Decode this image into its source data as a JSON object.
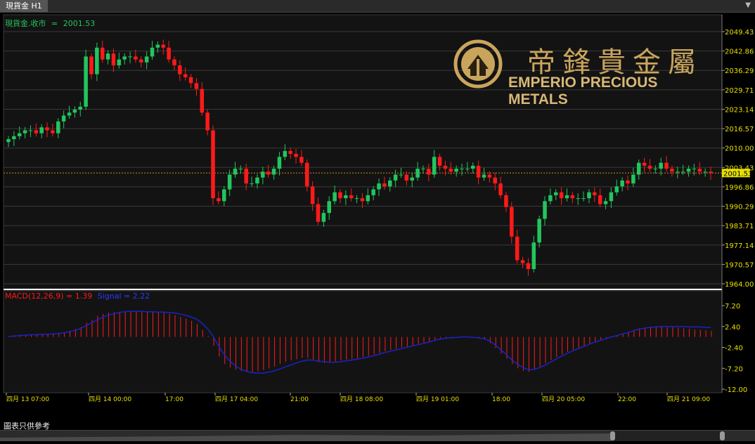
{
  "tab": {
    "label": "現貨金 H1"
  },
  "price_header": {
    "label": "現貨金.收市",
    "eq": "=",
    "value": "2001.53"
  },
  "macd_header": {
    "label": "MACD(12,26,9) = 1.39",
    "signal": "Signal = 2.22"
  },
  "logo": {
    "cn": "帝鋒貴金屬",
    "en": "EMPERIO PRECIOUS METALS"
  },
  "disclaimer": "圖表只供參考",
  "colors": {
    "up": "#22c55e",
    "down": "#ff1a1a",
    "signal": "#1a23c8",
    "axis_text": "#e8e000",
    "current_line": "#d98a1a"
  },
  "chart_data": {
    "type": "candlestick",
    "symbol": "現貨金",
    "timeframe": "H1",
    "current_price": 2001.53,
    "price_axis": {
      "ticks": [
        "2049.43",
        "2042.86",
        "2036.29",
        "2029.71",
        "2023.14",
        "2016.57",
        "2010.00",
        "2003.43",
        "1996.86",
        "1990.29",
        "1983.71",
        "1977.14",
        "1970.57",
        "1964.00"
      ],
      "range": [
        1964.0,
        2049.43
      ]
    },
    "macd_axis": {
      "ticks": [
        "7.20",
        "2.40",
        "-2.40",
        "-7.20",
        "-12.00"
      ],
      "range": [
        -12.0,
        7.2
      ]
    },
    "time_labels": [
      "四月 13 07:00",
      "四月 14 00:00",
      "17:00",
      "四月 17 04:00",
      "21:00",
      "四月 18 08:00",
      "四月 19 01:00",
      "18:00",
      "四月 20 05:00",
      "22:00",
      "四月 21 09:00"
    ],
    "close_series": [
      2013,
      2014,
      2015,
      2016,
      2016,
      2015,
      2017,
      2016,
      2015,
      2019,
      2021,
      2022,
      2023,
      2024,
      2041,
      2035,
      2044,
      2040,
      2042,
      2038,
      2040,
      2041,
      2041,
      2040,
      2039,
      2041,
      2044,
      2045,
      2044,
      2040,
      2038,
      2035,
      2034,
      2032,
      2030,
      2022,
      2016,
      1993,
      1992,
      1996,
      2001,
      2003,
      2003,
      1998,
      1998,
      2000,
      2002,
      2001,
      2003,
      2007,
      2009,
      2008,
      2007,
      2005,
      1997,
      1991,
      1985,
      1988,
      1992,
      1995,
      1993,
      1994,
      1993,
      1993,
      1992,
      1994,
      1996,
      1998,
      1997,
      1999,
      2001,
      2001,
      1999,
      2000,
      2003,
      2003,
      2001,
      2007,
      2004,
      2003,
      2002,
      2003,
      2003,
      2003,
      2004,
      2000,
      2001,
      2000,
      1998,
      1994,
      1990,
      1980,
      1972,
      1971,
      1969,
      1978,
      1986,
      1992,
      1994,
      1995,
      1993,
      1994,
      1993,
      1993,
      1993,
      1995,
      1994,
      1991,
      1992,
      1995,
      1997,
      1999,
      1998,
      2001,
      2005,
      2004,
      2003,
      2003,
      2005,
      2003,
      2002,
      2002,
      2002,
      2003,
      2003,
      2002,
      2002,
      2001.53
    ],
    "macd_histogram": [
      0.2,
      0.4,
      0.5,
      0.5,
      0.6,
      0.6,
      0.7,
      0.7,
      0.8,
      0.9,
      1.1,
      1.4,
      1.8,
      2.3,
      3.3,
      3.9,
      4.9,
      5.3,
      5.6,
      5.7,
      5.8,
      5.8,
      5.9,
      5.9,
      5.8,
      5.7,
      5.7,
      5.7,
      5.6,
      5.3,
      5.0,
      4.6,
      4.2,
      3.7,
      3.0,
      1.6,
      0.2,
      -2.0,
      -4.5,
      -6.2,
      -7.0,
      -7.5,
      -7.8,
      -8.0,
      -8.0,
      -7.9,
      -7.6,
      -7.2,
      -6.8,
      -6.2,
      -5.7,
      -5.4,
      -5.1,
      -4.8,
      -4.8,
      -5.2,
      -5.8,
      -6.0,
      -5.9,
      -5.6,
      -5.4,
      -5.2,
      -5.0,
      -4.9,
      -4.6,
      -4.3,
      -4.0,
      -3.7,
      -3.3,
      -3.0,
      -2.7,
      -2.4,
      -2.2,
      -1.9,
      -1.6,
      -1.3,
      -1.0,
      -0.6,
      -0.3,
      -0.2,
      -0.1,
      0.0,
      0.0,
      0.0,
      -0.1,
      -0.3,
      -0.5,
      -1.4,
      -2.5,
      -3.8,
      -5.0,
      -6.2,
      -7.2,
      -7.8,
      -8.0,
      -7.5,
      -6.8,
      -6.0,
      -5.3,
      -4.6,
      -4.0,
      -3.4,
      -2.9,
      -2.5,
      -2.0,
      -1.5,
      -1.0,
      -0.6,
      -0.3,
      0.1,
      0.5,
      0.8,
      1.1,
      1.6,
      2.0,
      2.2,
      2.3,
      2.3,
      2.3,
      2.2,
      2.2,
      2.1,
      2.0,
      1.9,
      1.7,
      1.6,
      1.5,
      1.39
    ],
    "macd_signal": [
      0.1,
      0.2,
      0.3,
      0.4,
      0.5,
      0.5,
      0.6,
      0.6,
      0.7,
      0.8,
      0.9,
      1.2,
      1.5,
      1.9,
      2.6,
      3.2,
      3.9,
      4.5,
      5.0,
      5.3,
      5.6,
      5.8,
      5.9,
      5.9,
      5.9,
      5.8,
      5.8,
      5.7,
      5.7,
      5.6,
      5.5,
      5.3,
      5.0,
      4.6,
      4.1,
      3.2,
      1.9,
      0.2,
      -2.1,
      -4.0,
      -5.5,
      -6.6,
      -7.4,
      -7.9,
      -8.2,
      -8.3,
      -8.3,
      -8.1,
      -7.8,
      -7.4,
      -6.9,
      -6.5,
      -6.0,
      -5.6,
      -5.3,
      -5.3,
      -5.5,
      -5.7,
      -5.8,
      -5.8,
      -5.7,
      -5.5,
      -5.3,
      -5.1,
      -4.9,
      -4.6,
      -4.3,
      -4.0,
      -3.6,
      -3.3,
      -3.0,
      -2.7,
      -2.4,
      -2.1,
      -1.8,
      -1.5,
      -1.2,
      -0.8,
      -0.5,
      -0.3,
      -0.2,
      -0.1,
      0.0,
      0.0,
      -0.1,
      -0.2,
      -0.4,
      -0.9,
      -1.8,
      -2.9,
      -4.0,
      -5.2,
      -6.2,
      -7.0,
      -7.5,
      -7.5,
      -7.1,
      -6.5,
      -5.8,
      -5.1,
      -4.4,
      -3.8,
      -3.2,
      -2.7,
      -2.2,
      -1.7,
      -1.2,
      -0.8,
      -0.4,
      0.0,
      0.3,
      0.7,
      1.0,
      1.4,
      1.8,
      2.0,
      2.2,
      2.3,
      2.4,
      2.4,
      2.4,
      2.4,
      2.4,
      2.3,
      2.3,
      2.3,
      2.2,
      2.22
    ]
  }
}
